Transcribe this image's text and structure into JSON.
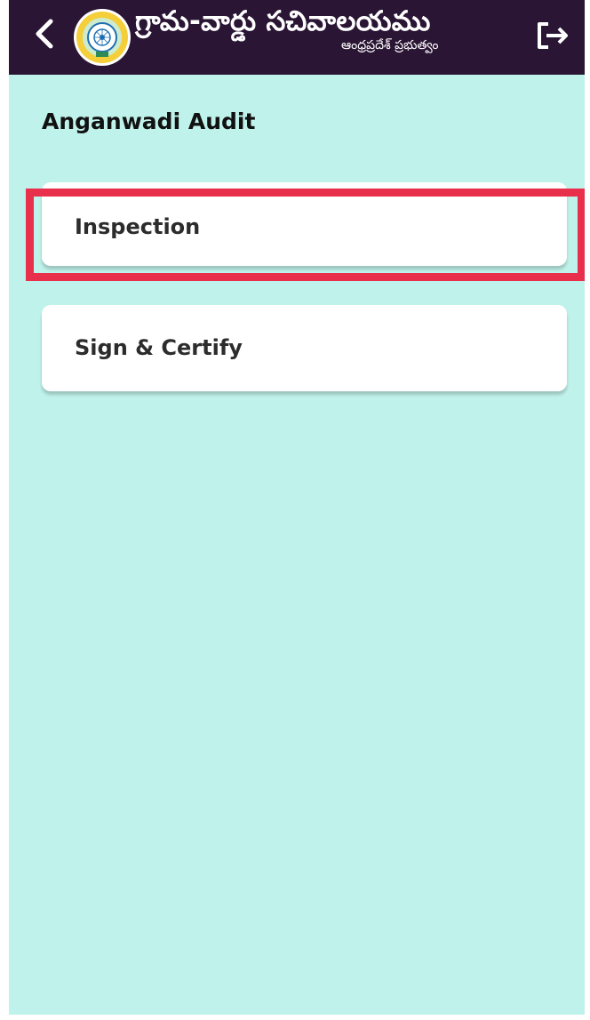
{
  "header": {
    "title": "గ్రామ-వార్డు సచివాలయము",
    "subtitle": "ఆంధ్రప్రదేశ్ ప్రభుత్వం",
    "back_icon": "chevron-left-icon",
    "logo_icon": "andhra-pradesh-emblem-icon",
    "logout_icon": "logout-icon"
  },
  "page": {
    "heading": "Anganwadi Audit"
  },
  "menu": {
    "items": [
      {
        "label": "Inspection",
        "highlighted": true
      },
      {
        "label": "Sign & Certify",
        "highlighted": false
      }
    ]
  },
  "colors": {
    "header_bg": "#2a1534",
    "page_bg": "#bff2ea",
    "card_bg": "#ffffff",
    "highlight": "#e8304c"
  }
}
